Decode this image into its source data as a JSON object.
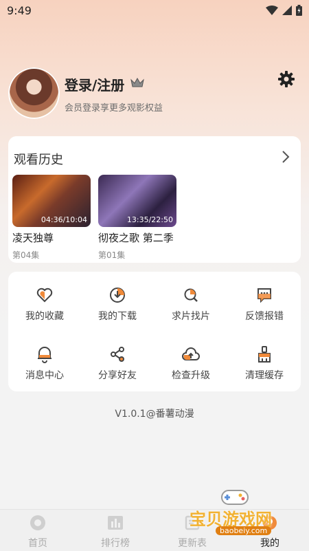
{
  "status_bar": {
    "time": "9:49"
  },
  "profile": {
    "login_label": "登录/注册",
    "subtitle": "会员登录享更多观影权益"
  },
  "history": {
    "title": "观看历史",
    "items": [
      {
        "title": "凌天独尊",
        "episode": "第04集",
        "progress_text": "04:36/10:04"
      },
      {
        "title": "彻夜之歌 第二季",
        "episode": "第01集",
        "progress_text": "13:35/22:50"
      }
    ]
  },
  "menu": {
    "items": [
      {
        "label": "我的收藏",
        "icon": "heart-icon"
      },
      {
        "label": "我的下载",
        "icon": "download-icon"
      },
      {
        "label": "求片找片",
        "icon": "search-film-icon"
      },
      {
        "label": "反馈报错",
        "icon": "feedback-icon"
      },
      {
        "label": "消息中心",
        "icon": "bell-icon"
      },
      {
        "label": "分享好友",
        "icon": "share-icon"
      },
      {
        "label": "检查升级",
        "icon": "upgrade-icon"
      },
      {
        "label": "清理缓存",
        "icon": "clean-icon"
      }
    ]
  },
  "version": "V1.0.1@番薯动漫",
  "bottom_nav": {
    "items": [
      {
        "label": "首页"
      },
      {
        "label": "排行榜"
      },
      {
        "label": "更新表"
      },
      {
        "label": "我的"
      }
    ],
    "active_index": 3
  },
  "watermark": {
    "text": "宝贝游戏网",
    "url": "baobeiy.com"
  },
  "colors": {
    "accent": "#f08a3a",
    "text": "#222222",
    "muted": "#888888"
  }
}
